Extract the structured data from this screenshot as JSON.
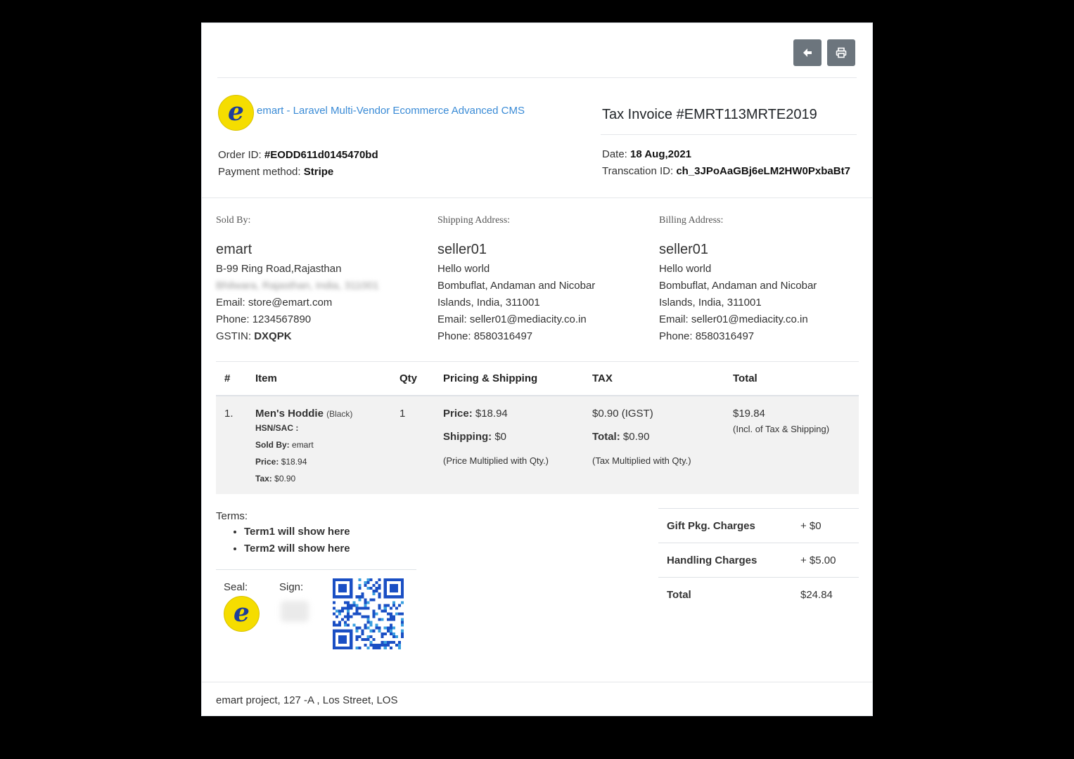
{
  "toolbar": {
    "back_icon": "arrow-left-icon",
    "print_icon": "print-icon"
  },
  "header": {
    "shop_name": "emart - Laravel Multi-Vendor Ecommerce Advanced CMS",
    "logo_letter": "e",
    "invoice_title": "Tax Invoice #EMRT113MRTE2019",
    "order_id_label": "Order ID:",
    "order_id": "#EODD611d0145470bd",
    "payment_label": "Payment method:",
    "payment_method": "Stripe",
    "date_label": "Date:",
    "date": "18 Aug,2021",
    "txn_label": "Transcation ID:",
    "txn_id": "ch_3JPoAaGBj6eLM2HW0PxbaBt7"
  },
  "sold_by": {
    "label": "Sold By:",
    "name": "emart",
    "line1": "B-99 Ring Road,Rajasthan",
    "line2_blurred": "Bhilwara, Rajasthan, India, 311001",
    "email_label": "Email:",
    "email": "store@emart.com",
    "phone_label": "Phone:",
    "phone": "1234567890",
    "gstin_label": "GSTIN:",
    "gstin": "DXQPK"
  },
  "shipping": {
    "label": "Shipping Address:",
    "name": "seller01",
    "line1": "Hello world",
    "line2": "Bombuflat, Andaman and Nicobar",
    "line3": "Islands, India, 311001",
    "email_label": "Email:",
    "email": "seller01@mediacity.co.in",
    "phone_label": "Phone:",
    "phone": "8580316497"
  },
  "billing": {
    "label": "Billing Address:",
    "name": "seller01",
    "line1": "Hello world",
    "line2": "Bombuflat, Andaman and Nicobar",
    "line3": "Islands, India, 311001",
    "email_label": "Email:",
    "email": "seller01@mediacity.co.in",
    "phone_label": "Phone:",
    "phone": "8580316497"
  },
  "table": {
    "headers": [
      "#",
      "Item",
      "Qty",
      "Pricing & Shipping",
      "TAX",
      "Total"
    ],
    "rows": [
      {
        "num": "1.",
        "item_name": "Men's Hoddie",
        "variant": "(Black)",
        "hsn_label": "HSN/SAC :",
        "sold_by_label": "Sold By:",
        "sold_by": "emart",
        "price_label": "Price:",
        "price": "$18.94",
        "tax_label": "Tax:",
        "tax": "$0.90",
        "qty": "1",
        "pricing_price_label": "Price:",
        "pricing_price": "$18.94",
        "shipping_label": "Shipping:",
        "shipping": "$0",
        "pricing_note": "(Price Multiplied with Qty.)",
        "tax_amount": "$0.90 (IGST)",
        "tax_total_label": "Total:",
        "tax_total": "$0.90",
        "tax_note": "(Tax Multiplied with Qty.)",
        "total": "$19.84",
        "total_note": "(Incl. of Tax & Shipping)"
      }
    ]
  },
  "terms": {
    "label": "Terms:",
    "items": [
      "Term1 will show here",
      "Term2 will show here"
    ]
  },
  "seal_label": "Seal:",
  "sign_label": "Sign:",
  "totals": [
    {
      "label": "Gift Pkg. Charges",
      "value": "+ $0"
    },
    {
      "label": "Handling Charges",
      "value": "+ $5.00"
    },
    {
      "label": "Total",
      "value": "$24.84"
    }
  ],
  "footer": "emart project, 127 -A , Los Street, LOS"
}
